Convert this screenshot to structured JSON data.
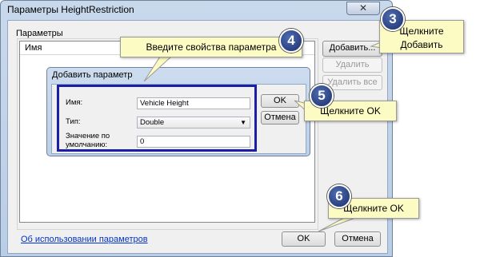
{
  "window": {
    "title": "Параметры HeightRestriction",
    "close_glyph": "✕",
    "group_label": "Параметры",
    "list_column": "Имя",
    "buttons": {
      "add": "Добавить...",
      "delete": "Удалить",
      "delete_all": "Удалить все",
      "ok": "OK",
      "cancel": "Отмена"
    },
    "help_link": "Об использовании параметров"
  },
  "dialog": {
    "title": "Добавить параметр",
    "name_label": "Имя:",
    "name_value": "Vehicle Height",
    "type_label": "Тип:",
    "type_value": "Double",
    "default_label": "Значение по умолчанию:",
    "default_value": "0",
    "ok": "OK",
    "cancel": "Отмена"
  },
  "callouts": {
    "step3": {
      "number": "3",
      "text_line1": "Щелкните",
      "text_line2": "Добавить"
    },
    "step4": {
      "number": "4",
      "text": "Введите свойства параметра"
    },
    "step5": {
      "number": "5",
      "text": "Щелкните OK"
    },
    "step6": {
      "number": "6",
      "text": "Щелкните OK"
    }
  },
  "colors": {
    "highlight_frame": "#1b1ea8",
    "callout_bg": "#fdfbc4",
    "badge": "#2b3f85"
  }
}
